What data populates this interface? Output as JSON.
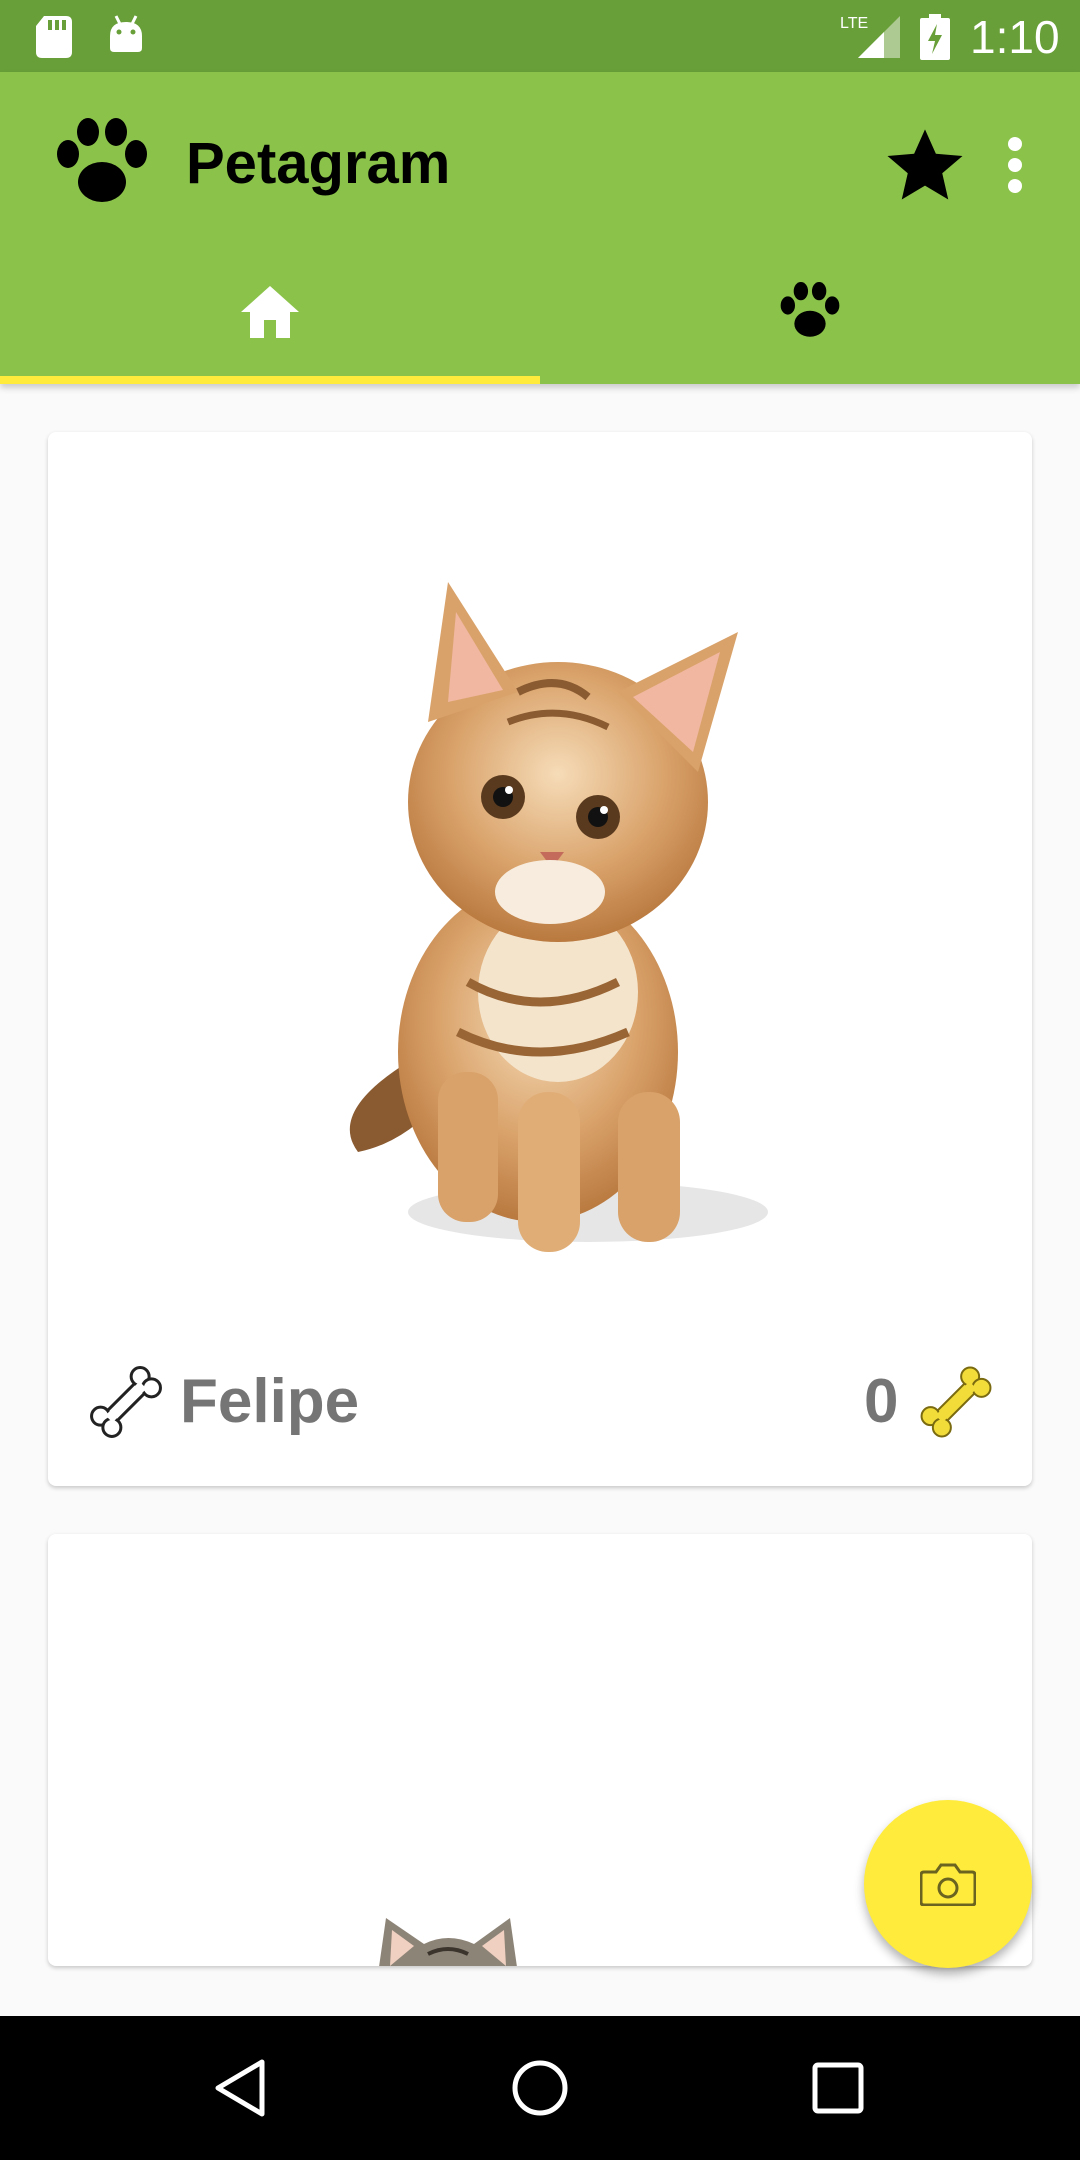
{
  "status_bar": {
    "network": "LTE",
    "time": "1:10"
  },
  "app_bar": {
    "title": "Petagram",
    "logo_icon": "paw-icon",
    "actions": [
      "star-icon",
      "more-vert-icon"
    ]
  },
  "tabs": [
    {
      "icon": "home-icon",
      "selected": true
    },
    {
      "icon": "paw-icon",
      "selected": false
    }
  ],
  "cards": [
    {
      "name": "Felipe",
      "likes": "0",
      "left_icon": "bone-outline-icon",
      "right_icon": "bone-gold-icon"
    }
  ],
  "fab": {
    "icon": "camera-icon"
  },
  "colors": {
    "primary_dark": "#689f38",
    "primary": "#8bc34a",
    "accent": "#ffeb3b",
    "text_secondary": "#757575"
  }
}
